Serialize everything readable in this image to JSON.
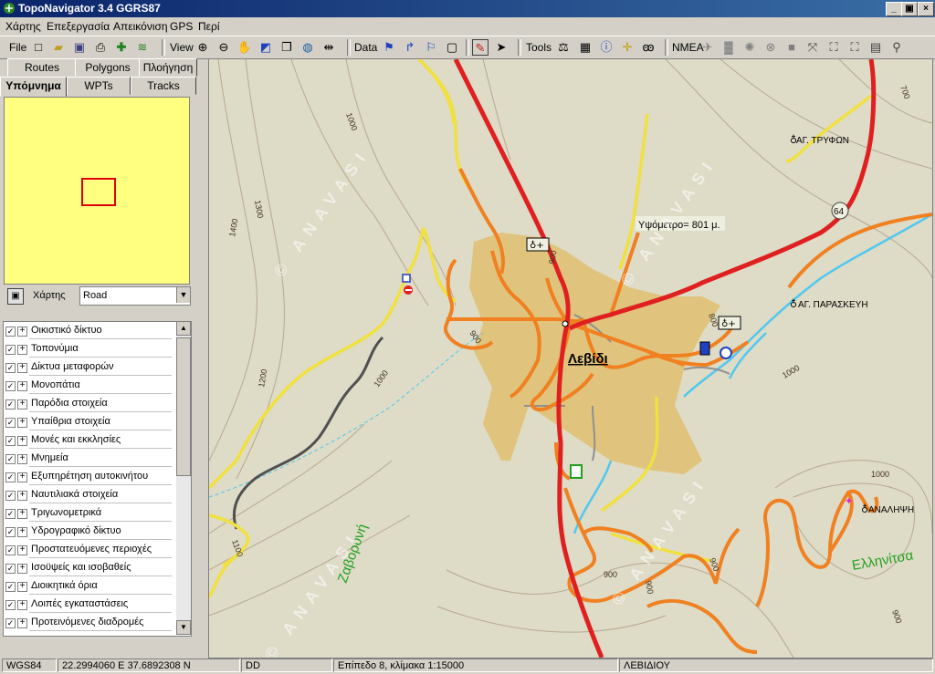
{
  "app": {
    "title": "TopoNavigator 3.4 GGRS87"
  },
  "window_buttons": {
    "minimize": "_",
    "maximize": "▣",
    "close": "×"
  },
  "menu": [
    "Χάρτης",
    "Επεξεργασία",
    "Απεικόνιση",
    "GPS",
    "Περί"
  ],
  "toolbar": {
    "file": "File",
    "view": "View",
    "data": "Data",
    "tools": "Tools",
    "nmea": "NMEA"
  },
  "tabs_row1": [
    "Routes",
    "Polygons",
    "Πλοήγηση"
  ],
  "tabs_row2": [
    "Υπόμνημα",
    "WPTs",
    "Tracks"
  ],
  "map_selector": {
    "label": "Χάρτης",
    "value": "Road"
  },
  "layers": [
    "Οικιστικό δίκτυο",
    "Τοπονύμια",
    "Δίκτυα μεταφορών",
    "Μονοπάτια",
    "Παρόδια στοιχεία",
    "Υπαίθρια στοιχεία",
    "Μονές και εκκλησίες",
    "Μνημεία",
    "Εξυπηρέτηση αυτοκινήτου",
    "Ναυτιλιακά στοιχεία",
    "Τριγωνομετρικά",
    "Υδρογραφικό δίκτυο",
    "Προστατευόμενες περιοχές",
    "Ισοϋψείς και ισοβαθείς",
    "Διοικητικά όρια",
    "Λοιπές εγκαταστάσεις",
    "Προτεινόμενες διαδρομές"
  ],
  "map": {
    "town": "Λεβίδι",
    "tooltip": "Υψόμετρο= 801 μ.",
    "places": [
      "ΑΓ. ΤΡΥΦΩΝ",
      "ΑΓ. ΠΑΡΑΣΚΕΥΗ",
      "ΑΝΑΛΗΨΗ"
    ],
    "green_names": [
      "Ζαβορυνή",
      "Ελληνίτσα"
    ],
    "road_number": "64",
    "contours": [
      "700",
      "1000",
      "1300",
      "1400",
      "1200",
      "1000",
      "900",
      "900",
      "800",
      "1000",
      "900",
      "900",
      "1100",
      "900",
      "900",
      "1000"
    ],
    "watermark": "© ANAVASI",
    "colors": {
      "main_road": "#e02020",
      "secondary": "#f08020",
      "local": "#f0e040",
      "water": "#50c8f0",
      "settlement": "#e0c070"
    }
  },
  "status": {
    "datum": "WGS84",
    "coords": "22.2994060 E  37.6892308 N",
    "format": "DD",
    "level": "Επίπεδο 8, κλίμακα 1:15000",
    "place": "ΛΕΒΙΔΙΟΥ"
  }
}
